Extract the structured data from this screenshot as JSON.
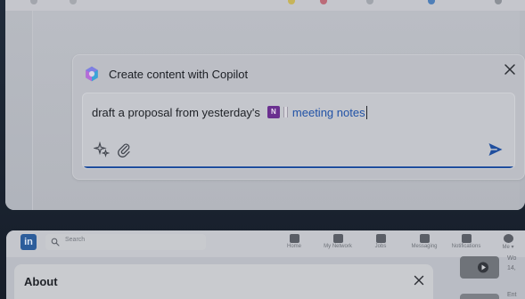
{
  "copilot": {
    "title": "Create content with Copilot",
    "prompt_text": "draft a proposal from yesterday's",
    "mention_text": "meeting notes",
    "onenote_badge": "N",
    "icons": {
      "logo": "copilot-icon",
      "close": "close-icon",
      "sparkle": "sparkle-icon",
      "attach": "paperclip-icon",
      "send": "send-icon"
    }
  },
  "linkedin": {
    "logo": "in",
    "search_placeholder": "Search",
    "nav_items": [
      {
        "label": "Home",
        "icon": "home-icon"
      },
      {
        "label": "My Network",
        "icon": "network-icon"
      },
      {
        "label": "Jobs",
        "icon": "jobs-icon"
      },
      {
        "label": "Messaging",
        "icon": "message-icon"
      },
      {
        "label": "Notifications",
        "icon": "bell-icon"
      },
      {
        "label": "Me ▾",
        "icon": "avatar-icon"
      }
    ],
    "about_title": "About",
    "side_items": [
      {
        "line1": "Wo",
        "line2": "14,"
      },
      {
        "line1": "Ent"
      }
    ]
  },
  "colors": {
    "accent_blue": "#2152a6",
    "send_blue": "#1f4e9e",
    "onenote_purple": "#6a2f8f",
    "linkedin_blue": "#2c5d9b"
  }
}
